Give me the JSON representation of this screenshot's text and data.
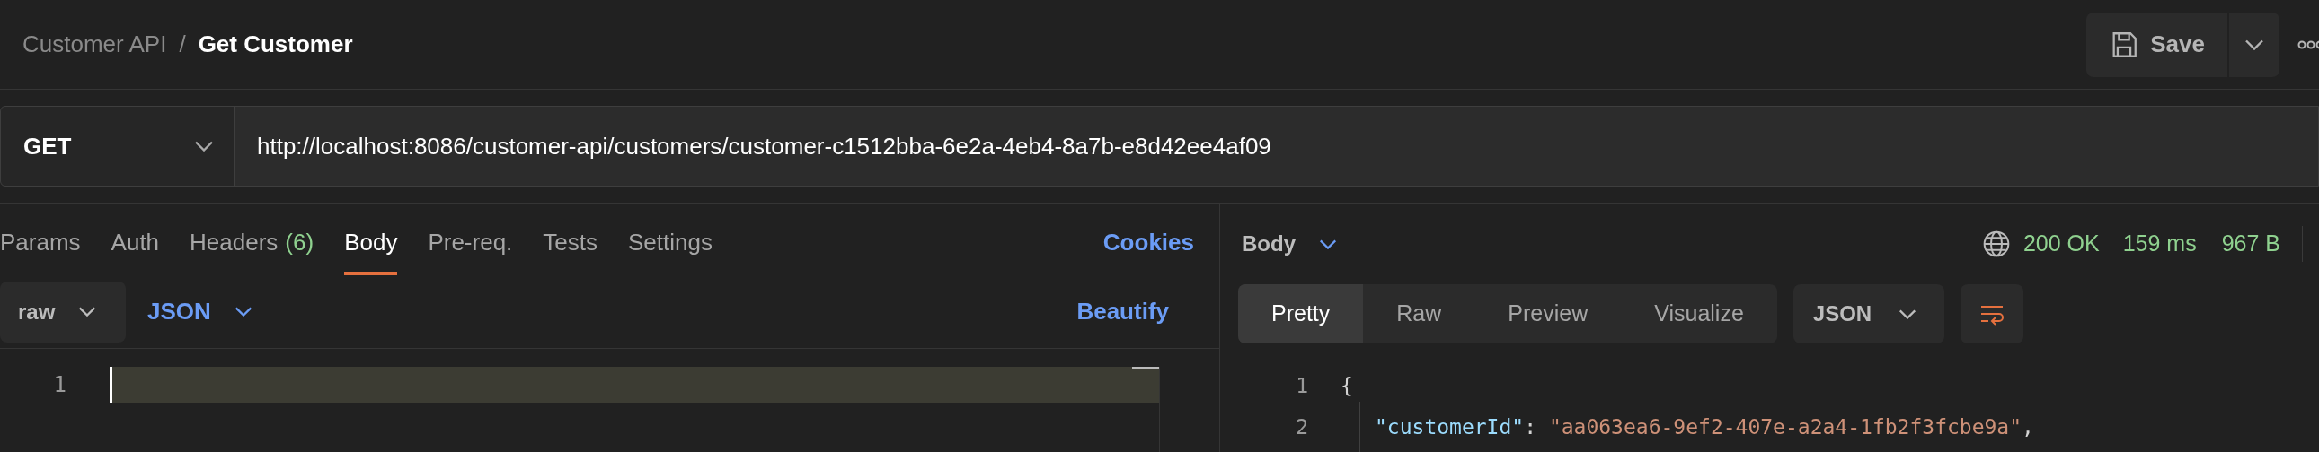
{
  "breadcrumb": {
    "collection": "Customer API",
    "separator": "/",
    "request": "Get Customer"
  },
  "toolbar": {
    "save": "Save"
  },
  "request": {
    "method": "GET",
    "url": "http://localhost:8086/customer-api/customers/customer-c1512bba-6e2a-4eb4-8a7b-e8d42ee4af09"
  },
  "request_tabs": [
    {
      "label": "Params",
      "selected": false
    },
    {
      "label": "Auth",
      "selected": false
    },
    {
      "label": "Headers",
      "count": "(6)",
      "selected": false
    },
    {
      "label": "Body",
      "selected": true
    },
    {
      "label": "Pre-req.",
      "selected": false
    },
    {
      "label": "Tests",
      "selected": false
    },
    {
      "label": "Settings",
      "selected": false
    }
  ],
  "cookies": "Cookies",
  "body_options": {
    "mode": "raw",
    "language": "JSON",
    "beautify": "Beautify"
  },
  "editor": {
    "line_numbers": [
      "1"
    ]
  },
  "response": {
    "section": "Body",
    "status": "200 OK",
    "time": "159 ms",
    "size": "967 B",
    "view_tabs": [
      {
        "label": "Pretty",
        "selected": true
      },
      {
        "label": "Raw",
        "selected": false
      },
      {
        "label": "Preview",
        "selected": false
      },
      {
        "label": "Visualize",
        "selected": false
      }
    ],
    "format": "JSON",
    "lines": [
      {
        "number": "1",
        "tokens": [
          {
            "kind": "punct",
            "text": "{"
          }
        ]
      },
      {
        "number": "2",
        "tokens": [
          {
            "kind": "key",
            "text": "\"customerId\""
          },
          {
            "kind": "punct",
            "text": ": "
          },
          {
            "kind": "string",
            "text": "\"aa063ea6-9ef2-407e-a2a4-1fb2f3fcbe9a\""
          },
          {
            "kind": "punct",
            "text": ","
          }
        ]
      }
    ]
  }
}
